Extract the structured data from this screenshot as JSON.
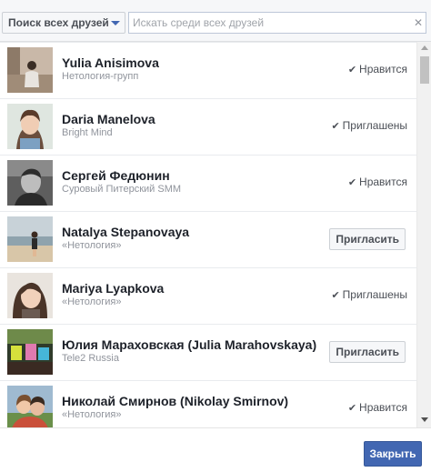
{
  "toolbar": {
    "filter_label": "Поиск всех друзей",
    "search_placeholder": "Искать среди всех друзей",
    "search_value": ""
  },
  "friends": [
    {
      "name": "Yulia Anisimova",
      "subtitle": "Нетология-групп",
      "action": "status",
      "status": "Нравится"
    },
    {
      "name": "Daria Manelova",
      "subtitle": "Bright Mind",
      "action": "status",
      "status": "Приглашены"
    },
    {
      "name": "Сергей Федюнин",
      "subtitle": "Суровый Питерский SMM",
      "action": "status",
      "status": "Нравится"
    },
    {
      "name": "Natalya Stepanovaya",
      "subtitle": "«Нетология»",
      "action": "invite",
      "invite_label": "Пригласить"
    },
    {
      "name": "Mariya Lyapkova",
      "subtitle": "«Нетология»",
      "action": "status",
      "status": "Приглашены"
    },
    {
      "name": "Юлия Мараховская (Julia Marahovskaya)",
      "subtitle": "Tele2 Russia",
      "action": "invite",
      "invite_label": "Пригласить"
    },
    {
      "name": "Николай Смирнов (Nikolay Smirnov)",
      "subtitle": "«Нетология»",
      "action": "status",
      "status": "Нравится"
    }
  ],
  "footer": {
    "close_label": "Закрыть"
  },
  "colors": {
    "accent": "#4267b2",
    "text": "#1d2129",
    "muted": "#90949c"
  }
}
